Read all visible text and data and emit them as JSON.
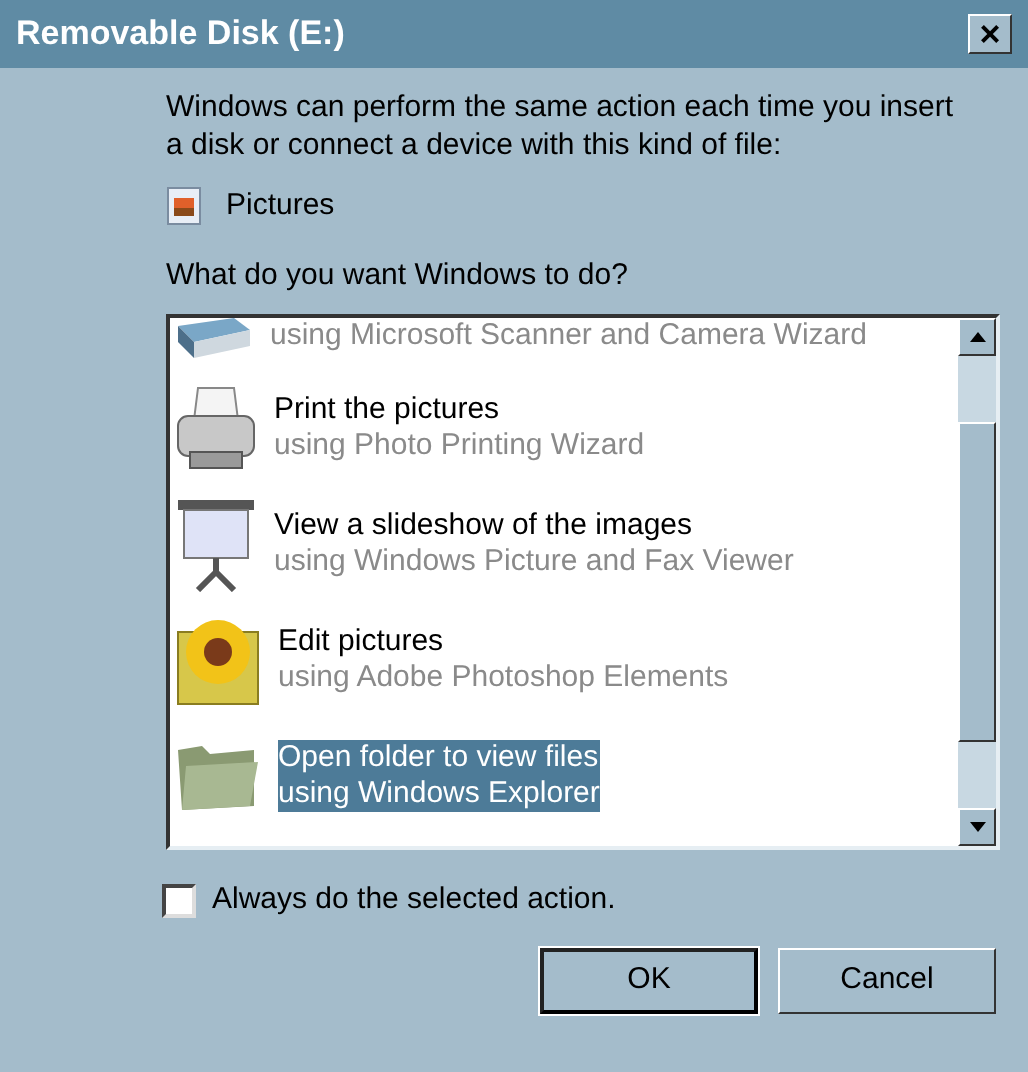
{
  "window": {
    "title": "Removable Disk (E:)",
    "close": "×"
  },
  "intro": "Windows can perform the same action each time you insert a disk or connect a device with this kind of file:",
  "content_type": "Pictures",
  "question": "What do you want Windows to do?",
  "actions": [
    {
      "subtitle": "using Microsoft Scanner and Camera Wizard",
      "selected": false
    },
    {
      "title": "Print the pictures",
      "subtitle": "using Photo Printing Wizard",
      "selected": false
    },
    {
      "title": "View a slideshow of the images",
      "subtitle": "using Windows Picture and Fax Viewer",
      "selected": false
    },
    {
      "title": "Edit pictures",
      "subtitle": "using Adobe Photoshop Elements",
      "selected": false
    },
    {
      "title": "Open folder to view files",
      "subtitle": "using Windows Explorer",
      "selected": true
    }
  ],
  "always_checkbox": {
    "label": "Always do the selected action.",
    "checked": false
  },
  "buttons": [
    {
      "label": "OK",
      "default": true
    },
    {
      "label": "Cancel",
      "default": false
    }
  ]
}
